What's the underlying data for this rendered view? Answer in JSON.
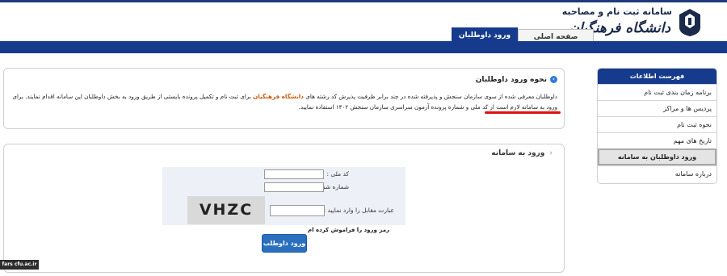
{
  "header": {
    "logo_title": "سامانه ثبت نام و مصاحبه",
    "logo_subtitle": "دانشگاه فرهنگیان",
    "tabs": [
      {
        "label": "صفحه اصلی"
      },
      {
        "label": "ورود داوطلبان"
      }
    ],
    "nav_color": "#163a8c"
  },
  "info_panel": {
    "title": "نحوه ورود داوطلبان",
    "text_before": "داوطلبان معرفی شده از سوی سازمان سنجش و پذیرفته شده در چند برابر ظرفیت پذیرش کد رشته های",
    "university": "دانشگاه فرهنگیان",
    "text_after": "برای ثبت نام و تکمیل پرونده بایستی از طریق ورود به بخش داوطلبان این سامانه اقدام نمایند. برای ورود به سامانه لازم است از کد ملی و شماره پرونده آزمون سراسری سازمان سنجش ۱۴۰۲ استفاده نمایید."
  },
  "login_panel": {
    "title": "ورود به سامانه",
    "national_code_label": "کد ملی :",
    "national_code_value": "",
    "id_number_label": "شماره شناسنامه:",
    "id_number_value": "",
    "captcha_label": "عبارت مقابل را وارد نمایید :",
    "captcha_text": "VHZC",
    "captcha_value": "",
    "forgot_password": "رمز ورود را فراموش کرده ام",
    "submit_label": "ورود داوطلب"
  },
  "sidebar": {
    "title": "فهرست اطلاعات",
    "items": [
      {
        "label": "برنامه زمان بندی ثبت نام"
      },
      {
        "label": "پردیس ها و مراکز"
      },
      {
        "label": "نحوه ثبت نام"
      },
      {
        "label": "تاریخ های مهم"
      },
      {
        "label": "ورود داوطلبان به سامانه"
      },
      {
        "label": "درباره سامانه"
      }
    ]
  },
  "watermark": "fars cfu.ac.ir"
}
